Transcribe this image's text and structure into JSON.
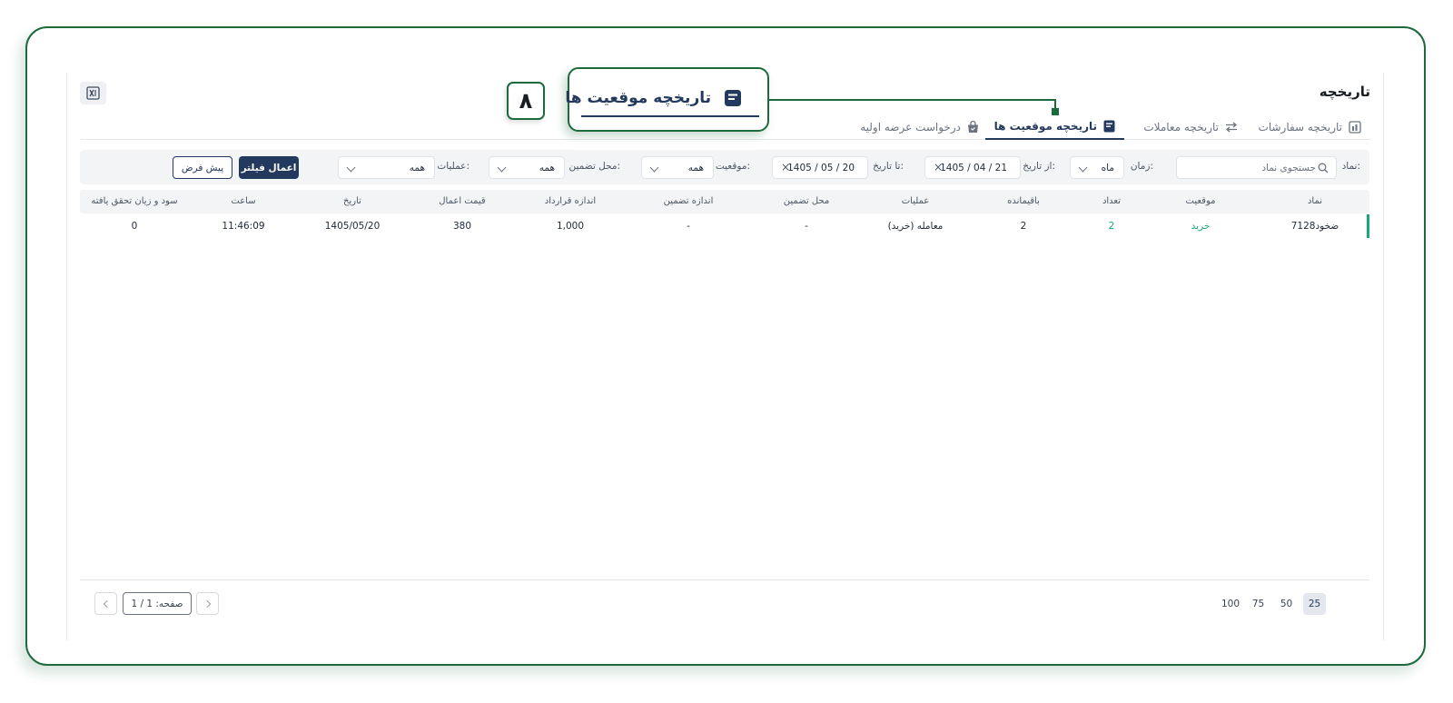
{
  "page": {
    "title": "تاریخچه",
    "export_icon": "excel-icon"
  },
  "tabs": [
    {
      "label": "تاریخچه سفارشات",
      "icon": "orders-icon",
      "active": false
    },
    {
      "label": "تاریخچه معاملات",
      "icon": "swap-arrows-icon",
      "active": false
    },
    {
      "label": "تاریخچه موقعیت ها",
      "icon": "document-list-icon",
      "active": true
    },
    {
      "label": "درخواست عرضه اولیه",
      "icon": "shopping-bag-icon",
      "active": false
    }
  ],
  "filters": {
    "symbol_label": "نماد:",
    "symbol_placeholder": "جستجوی نماد",
    "time_label": "زمان:",
    "time_value": "ماه",
    "from_label": "از تاریخ:",
    "from_value": "1405 / 04 / 21",
    "to_label": "تا تاریخ:",
    "to_value": "1405 / 05 / 20",
    "position_label": "موقعیت:",
    "position_value": "همه",
    "collateral_label": "محل تضمین:",
    "collateral_value": "همه",
    "operation_label": "عملیات:",
    "operation_value": "همه",
    "apply_label": "اعمال فیلتر",
    "default_label": "پیش فرض",
    "clear_symbol": "×"
  },
  "table": {
    "headers": [
      "نماد",
      "موقعیت",
      "تعداد",
      "باقیمانده",
      "عملیات",
      "محل تضمین",
      "اندازه تضمین",
      "اندازه قرارداد",
      "قیمت اعمال",
      "تاریخ",
      "ساعت",
      "سود و زیان تحقق یافته"
    ],
    "rows": [
      [
        "ضخود7128",
        "خرید",
        "2",
        "2",
        "معامله (خرید)",
        "-",
        "-",
        "1,000",
        "380",
        "1405/05/20",
        "11:46:09",
        "0"
      ]
    ]
  },
  "pagination": {
    "page_sizes": [
      "25",
      "50",
      "75",
      "100"
    ],
    "active_size": "25",
    "page_text": "صفحه: 1 / 1"
  },
  "annotation": {
    "callout_text": "تاریخچه موقعیت ها",
    "step_number": "۸",
    "accent_color": "#1d6b3c"
  },
  "colors": {
    "primary": "#23395d",
    "buy": "#17a97c"
  }
}
